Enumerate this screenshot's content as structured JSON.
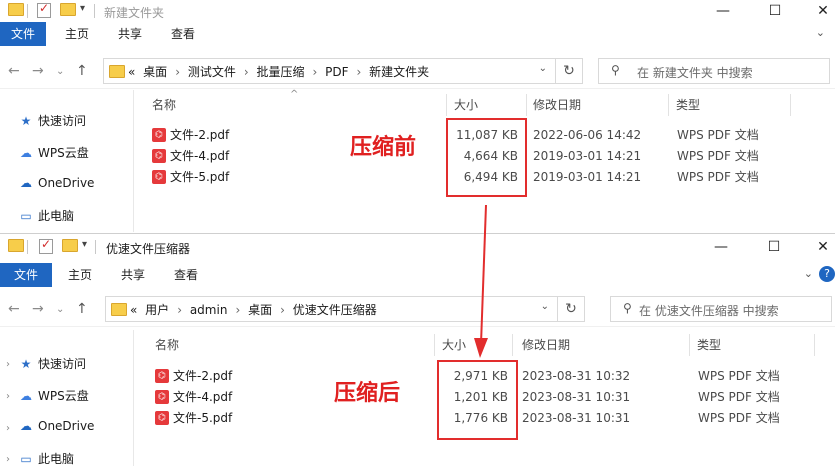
{
  "window_top": {
    "title": "新建文件夹",
    "ribbon_tabs": [
      "文件",
      "主页",
      "共享",
      "查看"
    ],
    "address_prefix": "«",
    "breadcrumbs": [
      "桌面",
      "测试文件",
      "批量压缩",
      "PDF",
      "新建文件夹"
    ],
    "search_placeholder": "在 新建文件夹 中搜索",
    "nav_items": [
      {
        "icon": "star-icon",
        "label": "快速访问"
      },
      {
        "icon": "cloud-icon",
        "label": "WPS云盘"
      },
      {
        "icon": "cloud-icon",
        "label": "OneDrive"
      },
      {
        "icon": "computer-icon",
        "label": "此电脑"
      }
    ],
    "columns": {
      "name": "名称",
      "size": "大小",
      "date": "修改日期",
      "type": "类型"
    },
    "files": [
      {
        "name": "文件-2.pdf",
        "size": "11,087 KB",
        "date": "2022-06-06 14:42",
        "type": "WPS PDF 文档"
      },
      {
        "name": "文件-4.pdf",
        "size": "4,664 KB",
        "date": "2019-03-01 14:21",
        "type": "WPS PDF 文档"
      },
      {
        "name": "文件-5.pdf",
        "size": "6,494 KB",
        "date": "2019-03-01 14:21",
        "type": "WPS PDF 文档"
      }
    ],
    "annotation": "压缩前"
  },
  "window_bottom": {
    "title": "优速文件压缩器",
    "ribbon_tabs": [
      "文件",
      "主页",
      "共享",
      "查看"
    ],
    "address_prefix": "«",
    "breadcrumbs": [
      "用户",
      "admin",
      "桌面",
      "优速文件压缩器"
    ],
    "search_placeholder": "在 优速文件压缩器 中搜索",
    "nav_items": [
      {
        "icon": "star-icon",
        "label": "快速访问"
      },
      {
        "icon": "cloud-icon",
        "label": "WPS云盘"
      },
      {
        "icon": "cloud-icon",
        "label": "OneDrive"
      },
      {
        "icon": "computer-icon",
        "label": "此电脑"
      }
    ],
    "columns": {
      "name": "名称",
      "size": "大小",
      "date": "修改日期",
      "type": "类型"
    },
    "files": [
      {
        "name": "文件-2.pdf",
        "size": "2,971 KB",
        "date": "2023-08-31 10:32",
        "type": "WPS PDF 文档"
      },
      {
        "name": "文件-4.pdf",
        "size": "1,201 KB",
        "date": "2023-08-31 10:31",
        "type": "WPS PDF 文档"
      },
      {
        "name": "文件-5.pdf",
        "size": "1,776 KB",
        "date": "2023-08-31 10:31",
        "type": "WPS PDF 文档"
      }
    ],
    "annotation": "压缩后"
  },
  "colors": {
    "accent": "#1f66c1",
    "annotation": "#e22d2d",
    "pdf_icon": "#e5393b",
    "folder": "#f7cd4a"
  }
}
